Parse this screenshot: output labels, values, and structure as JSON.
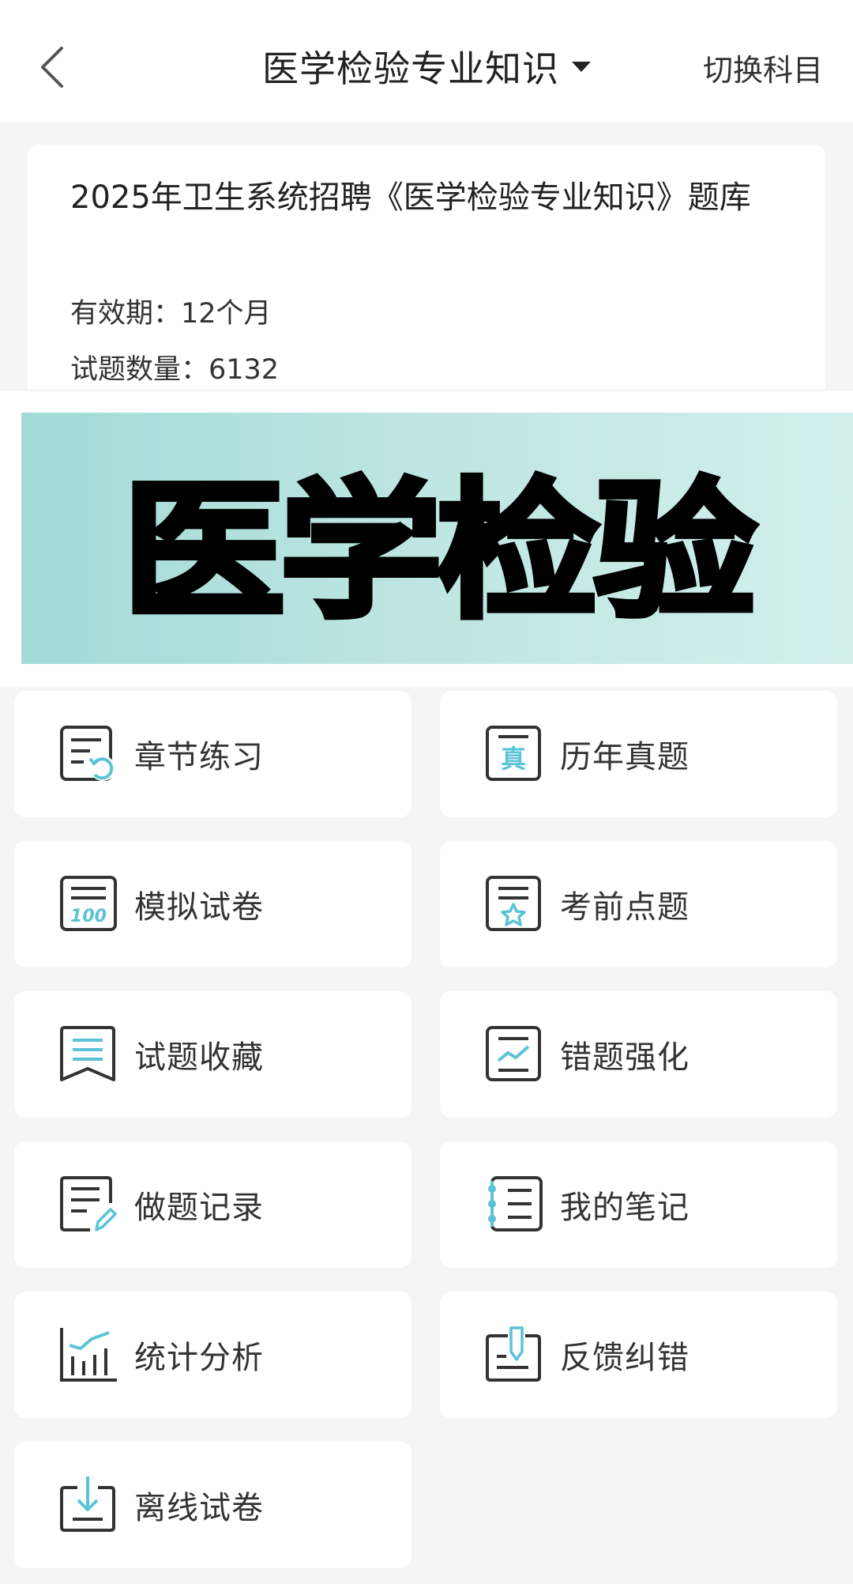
{
  "header": {
    "title": "医学检验专业知识",
    "switch_label": "切换科目"
  },
  "info": {
    "title": "2025年卫生系统招聘《医学检验专业知识》题库",
    "validity": "有效期：12个月",
    "question_count": "试题数量：6132"
  },
  "banner": {
    "text": "医学检验"
  },
  "menu": [
    {
      "label": "章节练习",
      "icon": "chapter-practice-icon"
    },
    {
      "label": "历年真题",
      "icon": "past-exams-icon"
    },
    {
      "label": "模拟试卷",
      "icon": "mock-paper-icon"
    },
    {
      "label": "考前点题",
      "icon": "pre-exam-tips-icon"
    },
    {
      "label": "试题收藏",
      "icon": "favorites-icon"
    },
    {
      "label": "错题强化",
      "icon": "wrong-questions-icon"
    },
    {
      "label": "做题记录",
      "icon": "practice-record-icon"
    },
    {
      "label": "我的笔记",
      "icon": "notes-icon"
    },
    {
      "label": "统计分析",
      "icon": "statistics-icon"
    },
    {
      "label": "反馈纠错",
      "icon": "feedback-icon"
    },
    {
      "label": "离线试卷",
      "icon": "offline-download-icon"
    }
  ],
  "colors": {
    "accent": "#5bc3d6",
    "icon_stroke": "#333333"
  }
}
